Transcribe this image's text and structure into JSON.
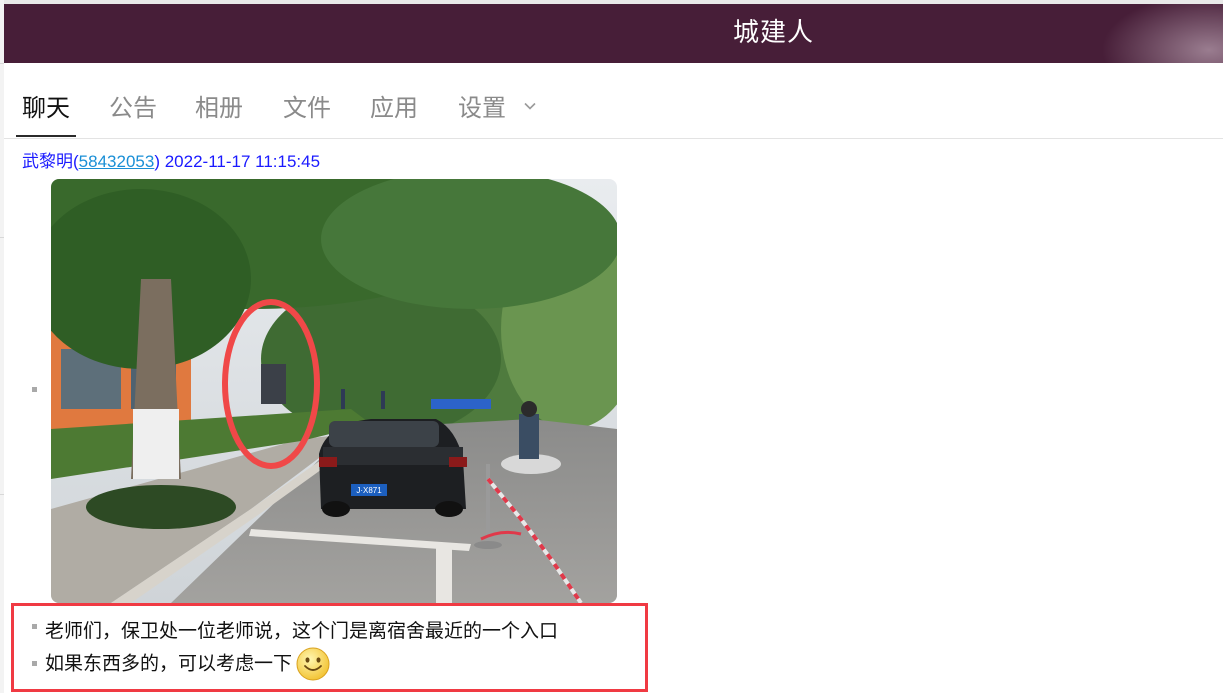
{
  "window": {
    "title": "城建人",
    "header_color": "#471e38"
  },
  "tabs": [
    {
      "label": "聊天",
      "active": true
    },
    {
      "label": "公告",
      "active": false
    },
    {
      "label": "相册",
      "active": false
    },
    {
      "label": "文件",
      "active": false
    },
    {
      "label": "应用",
      "active": false
    },
    {
      "label": "设置",
      "active": false,
      "has_dropdown": true
    }
  ],
  "message": {
    "sender_name": "武黎明",
    "open_paren": "(",
    "sender_id": "58432053",
    "close_paren": ")",
    "timestamp": "2022-11-17 11:15:45",
    "image_plate_text": "J·X871",
    "lines": [
      "老师们，保卫处一位老师说，这个门是离宿舍最近的一个入口",
      "如果东西多的，可以考虑一下"
    ],
    "emoji": "smile-emoji"
  },
  "colors": {
    "accent_link": "#1a8fd6",
    "sender_text": "#1a1aff",
    "highlight": "#f03a43",
    "annotation_circle": "#f04848"
  }
}
